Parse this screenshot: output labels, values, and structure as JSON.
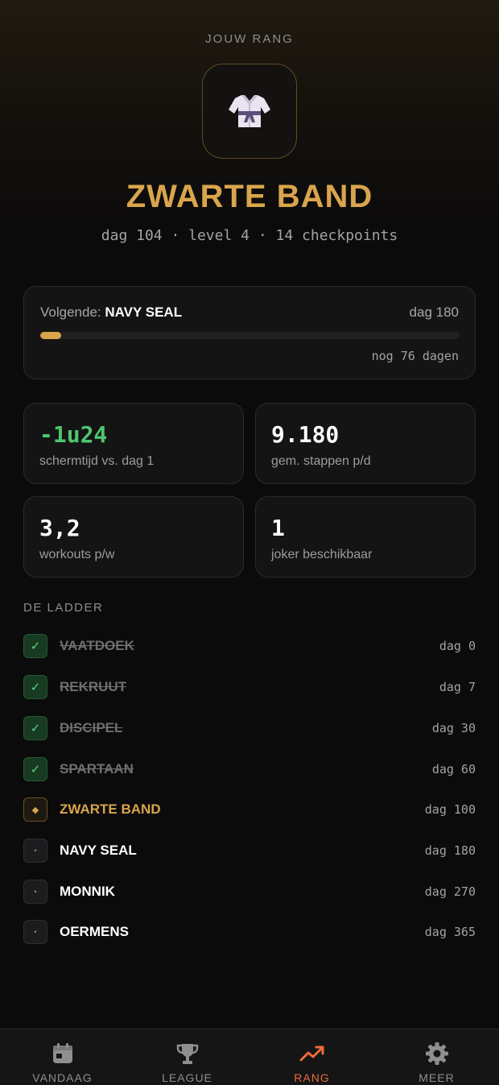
{
  "header": {
    "label": "JOUW RANG",
    "badge_icon": "karate-gi-icon",
    "rank": "ZWARTE BAND",
    "meta": "dag 104 · level 4 · 14 checkpoints"
  },
  "next": {
    "prefix": "Volgende: ",
    "name": "NAVY SEAL",
    "day": "dag 180",
    "remaining": "nog 76 dagen",
    "progress_fraction": 0.05
  },
  "stats": [
    {
      "value": "-1u24",
      "label": "schermtijd vs. dag 1",
      "accent": "#4cc66e"
    },
    {
      "value": "9.180",
      "label": "gem. stappen p/d"
    },
    {
      "value": "3,2",
      "label": "workouts p/w"
    },
    {
      "value": "1",
      "label": "joker beschikbaar"
    }
  ],
  "ladder": {
    "heading": "DE LADDER",
    "items": [
      {
        "name": "VAATDOEK",
        "day": "dag 0",
        "status": "done",
        "mark": "✓"
      },
      {
        "name": "REKRUUT",
        "day": "dag 7",
        "status": "done",
        "mark": "✓"
      },
      {
        "name": "DISCIPEL",
        "day": "dag 30",
        "status": "done",
        "mark": "✓"
      },
      {
        "name": "SPARTAAN",
        "day": "dag 60",
        "status": "done",
        "mark": "✓"
      },
      {
        "name": "ZWARTE BAND",
        "day": "dag 100",
        "status": "current",
        "mark": "◆"
      },
      {
        "name": "NAVY SEAL",
        "day": "dag 180",
        "status": "todo",
        "mark": "•"
      },
      {
        "name": "MONNIK",
        "day": "dag 270",
        "status": "todo",
        "mark": "•"
      },
      {
        "name": "OERMENS",
        "day": "dag 365",
        "status": "todo",
        "mark": "•"
      }
    ]
  },
  "tabs": [
    {
      "label": "VANDAAG",
      "icon": "calendar-icon",
      "active": false
    },
    {
      "label": "LEAGUE",
      "icon": "trophy-icon",
      "active": false
    },
    {
      "label": "RANG",
      "icon": "trending-up-icon",
      "active": true
    },
    {
      "label": "MEER",
      "icon": "gear-icon",
      "active": false
    }
  ],
  "colors": {
    "accent_gold": "#d9a54c",
    "accent_orange": "#ee6a3a",
    "positive_green": "#4cc66e"
  }
}
